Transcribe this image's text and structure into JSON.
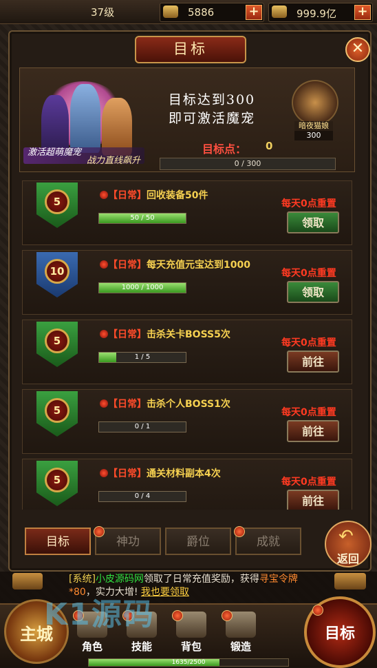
{
  "topbar": {
    "level": "37级",
    "coins": "5886",
    "gold": "999.9亿",
    "plus": "+"
  },
  "panel": {
    "title": "目标",
    "close": "✕"
  },
  "banner": {
    "goal_line1": "目标达到300",
    "goal_line2": "即可激活魔宠",
    "tagline1": "激活超萌魔宠",
    "tagline2": "战力直线飙升",
    "pet_name": "暗夜猫娘",
    "pet_points": "300",
    "points_label": "目标点：",
    "points_value": "0",
    "progress_text": "0 / 300",
    "progress": 0
  },
  "tasks": [
    {
      "level": "5",
      "tag": "【日常】",
      "name": "回收装备50件",
      "progress_text": "50 / 50",
      "progress": 1.0,
      "reset": "每天0点重置",
      "button": "领取",
      "button_type": "claim",
      "badge_color": "green"
    },
    {
      "level": "10",
      "tag": "【日常】",
      "name": "每天充值元宝达到1000",
      "progress_text": "1000 / 1000",
      "progress": 1.0,
      "reset": "每天0点重置",
      "button": "领取",
      "button_type": "claim",
      "badge_color": "blue"
    },
    {
      "level": "5",
      "tag": "【日常】",
      "name": "击杀关卡BOSS5次",
      "progress_text": "1 / 5",
      "progress": 0.2,
      "reset": "每天0点重置",
      "button": "前往",
      "button_type": "go",
      "badge_color": "green"
    },
    {
      "level": "5",
      "tag": "【日常】",
      "name": "击杀个人BOSS1次",
      "progress_text": "0 / 1",
      "progress": 0,
      "reset": "每天0点重置",
      "button": "前往",
      "button_type": "go",
      "badge_color": "green"
    },
    {
      "level": "5",
      "tag": "【日常】",
      "name": "通关材料副本4次",
      "progress_text": "0 / 4",
      "progress": 0,
      "reset": "每天0点重置",
      "button": "前往",
      "button_type": "go",
      "badge_color": "green"
    }
  ],
  "tabs": [
    {
      "label": "目标",
      "active": true
    },
    {
      "label": "神功",
      "active": false
    },
    {
      "label": "爵位",
      "active": false
    },
    {
      "label": "成就",
      "active": false
    }
  ],
  "back_label": "返回",
  "chat": {
    "sys": "[系统]",
    "name": "小皮源码网",
    "msg1": "领取了日常充值奖励，获得",
    "item": "寻宝令牌*80",
    "msg2": "，实力大增!",
    "link": "我也要领取"
  },
  "nav": {
    "main_city": "主城",
    "items": [
      "角色",
      "技能",
      "背包",
      "锻造"
    ],
    "target": "目标",
    "exp_text": "1635/2500",
    "exp": 0.654
  },
  "watermark": "K1源码",
  "colors": {
    "accent_red": "#ff3a22",
    "gold_text": "#f5d050",
    "claim_green": "#3a8a3a"
  }
}
